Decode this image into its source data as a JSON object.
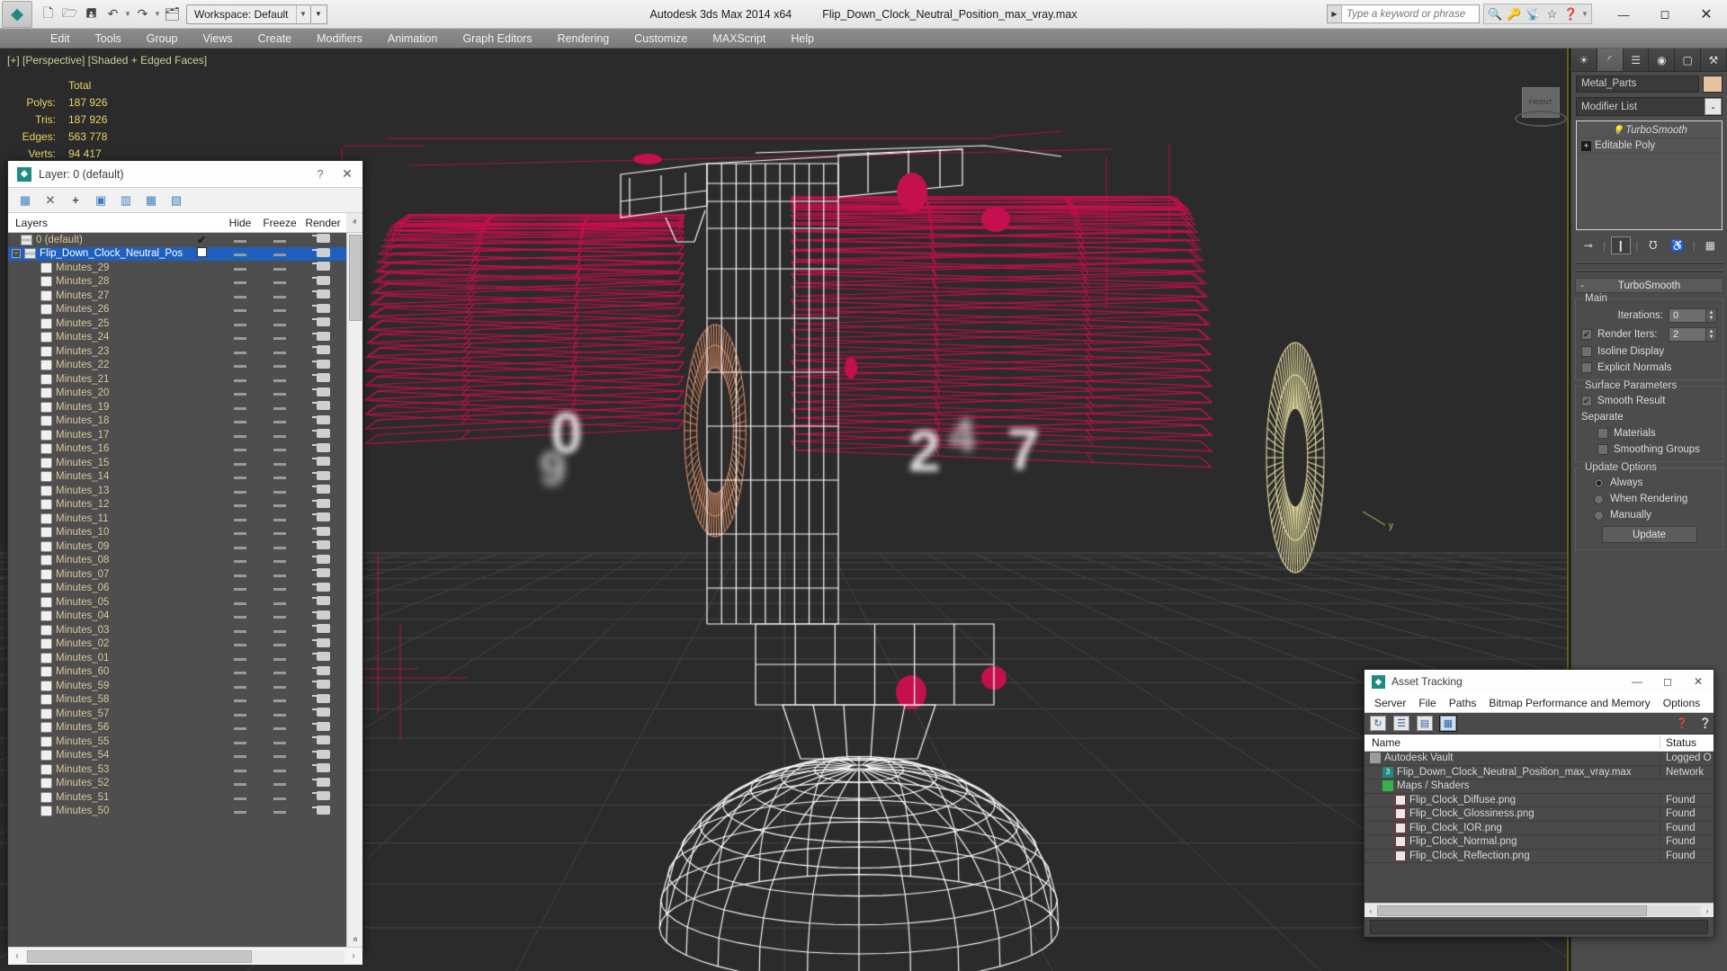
{
  "titlebar": {
    "app_logo": "3ds-max-logo",
    "quick_access": [
      {
        "name": "new-file",
        "glyph": "⬜"
      },
      {
        "name": "open-file",
        "glyph": "🗁"
      },
      {
        "name": "save-file",
        "glyph": "💾"
      },
      {
        "name": "undo",
        "glyph": "↶"
      },
      {
        "name": "redo",
        "glyph": "↷"
      },
      {
        "name": "set-project-folder",
        "glyph": "🗂"
      }
    ],
    "workspace_label": "Workspace: Default",
    "app_title": "Autodesk 3ds Max  2014 x64",
    "file_title": "Flip_Down_Clock_Neutral_Position_max_vray.max",
    "search_placeholder": "Type a keyword or phrase",
    "help_icons": [
      {
        "name": "binoculars-icon",
        "glyph": "🔭"
      },
      {
        "name": "key-icon",
        "glyph": "🔑"
      },
      {
        "name": "satellite-dish-icon",
        "glyph": "📡"
      },
      {
        "name": "star-icon",
        "glyph": "★"
      },
      {
        "name": "help-question-icon",
        "glyph": "?"
      }
    ],
    "window_controls": [
      {
        "name": "minimize-button",
        "glyph": "—"
      },
      {
        "name": "maximize-button",
        "glyph": "☐"
      },
      {
        "name": "close-button",
        "glyph": "✕"
      }
    ]
  },
  "menubar": {
    "items": [
      "Edit",
      "Tools",
      "Group",
      "Views",
      "Create",
      "Modifiers",
      "Animation",
      "Graph Editors",
      "Rendering",
      "Customize",
      "MAXScript",
      "Help"
    ]
  },
  "viewport": {
    "label": "[+] [Perspective] [Shaded + Edged Faces]",
    "stats": {
      "header": "Total",
      "rows": [
        {
          "label": "Polys:",
          "value": "187 926"
        },
        {
          "label": "Tris:",
          "value": "187 926"
        },
        {
          "label": "Edges:",
          "value": "563 778"
        },
        {
          "label": "Verts:",
          "value": "94 417"
        }
      ]
    },
    "viewcube_label": "FRONT",
    "colors": {
      "background": "#2b2b2b",
      "selection_wire": "#c4104f",
      "unselected_wire": "#ffffff",
      "gizmo_orange": "#e8956a",
      "gizmo_yellow": "#e8e0a0",
      "border": "#6f6220"
    }
  },
  "layer_dialog": {
    "title": "Layer: 0 (default)",
    "help_glyph": "?",
    "close_glyph": "✕",
    "toolbar": [
      {
        "name": "new-layer-icon",
        "glyph": "▤"
      },
      {
        "name": "delete-layer-icon",
        "glyph": "✕"
      },
      {
        "name": "add-selection-icon",
        "glyph": "+"
      },
      {
        "name": "select-objects-icon",
        "glyph": "▣"
      },
      {
        "name": "select-highlighted-icon",
        "glyph": "▥"
      },
      {
        "name": "highlight-selected-icon",
        "glyph": "▦"
      },
      {
        "name": "layer-properties-icon",
        "glyph": "▧"
      }
    ],
    "columns": [
      "Layers",
      "",
      "Hide",
      "Freeze",
      "Render"
    ],
    "scroll_up_glyph": "ⱏ",
    "scroll_down_glyph": "ⱞ",
    "hscroll_left_glyph": "‹",
    "hscroll_right_glyph": "›",
    "rows": [
      {
        "label": "0 (default)",
        "indent": 0,
        "icon": "layer-stack-icon",
        "selected": false,
        "expander": false,
        "check": "✔",
        "hide": "dash",
        "freeze": "dash",
        "render": "teapot"
      },
      {
        "label": "Flip_Down_Clock_Neutral_Position",
        "indent": 0,
        "icon": "layer-stack-icon",
        "selected": true,
        "expander": true,
        "check": "box",
        "hide": "dash",
        "freeze": "dash",
        "render": "teapot"
      },
      {
        "label": "Minutes_29",
        "indent": 2,
        "icon": "object-icon",
        "selected": false,
        "hide": "dash",
        "freeze": "dash",
        "render": "teapot"
      },
      {
        "label": "Minutes_28",
        "indent": 2,
        "icon": "object-icon",
        "selected": false,
        "hide": "dash",
        "freeze": "dash",
        "render": "teapot"
      },
      {
        "label": "Minutes_27",
        "indent": 2,
        "icon": "object-icon",
        "selected": false,
        "hide": "dash",
        "freeze": "dash",
        "render": "teapot"
      },
      {
        "label": "Minutes_26",
        "indent": 2,
        "icon": "object-icon",
        "selected": false,
        "hide": "dash",
        "freeze": "dash",
        "render": "teapot"
      },
      {
        "label": "Minutes_25",
        "indent": 2,
        "icon": "object-icon",
        "selected": false,
        "hide": "dash",
        "freeze": "dash",
        "render": "teapot"
      },
      {
        "label": "Minutes_24",
        "indent": 2,
        "icon": "object-icon",
        "selected": false,
        "hide": "dash",
        "freeze": "dash",
        "render": "teapot"
      },
      {
        "label": "Minutes_23",
        "indent": 2,
        "icon": "object-icon",
        "selected": false,
        "hide": "dash",
        "freeze": "dash",
        "render": "teapot"
      },
      {
        "label": "Minutes_22",
        "indent": 2,
        "icon": "object-icon",
        "selected": false,
        "hide": "dash",
        "freeze": "dash",
        "render": "teapot"
      },
      {
        "label": "Minutes_21",
        "indent": 2,
        "icon": "object-icon",
        "selected": false,
        "hide": "dash",
        "freeze": "dash",
        "render": "teapot"
      },
      {
        "label": "Minutes_20",
        "indent": 2,
        "icon": "object-icon",
        "selected": false,
        "hide": "dash",
        "freeze": "dash",
        "render": "teapot"
      },
      {
        "label": "Minutes_19",
        "indent": 2,
        "icon": "object-icon",
        "selected": false,
        "hide": "dash",
        "freeze": "dash",
        "render": "teapot"
      },
      {
        "label": "Minutes_18",
        "indent": 2,
        "icon": "object-icon",
        "selected": false,
        "hide": "dash",
        "freeze": "dash",
        "render": "teapot"
      },
      {
        "label": "Minutes_17",
        "indent": 2,
        "icon": "object-icon",
        "selected": false,
        "hide": "dash",
        "freeze": "dash",
        "render": "teapot"
      },
      {
        "label": "Minutes_16",
        "indent": 2,
        "icon": "object-icon",
        "selected": false,
        "hide": "dash",
        "freeze": "dash",
        "render": "teapot"
      },
      {
        "label": "Minutes_15",
        "indent": 2,
        "icon": "object-icon",
        "selected": false,
        "hide": "dash",
        "freeze": "dash",
        "render": "teapot"
      },
      {
        "label": "Minutes_14",
        "indent": 2,
        "icon": "object-icon",
        "selected": false,
        "hide": "dash",
        "freeze": "dash",
        "render": "teapot"
      },
      {
        "label": "Minutes_13",
        "indent": 2,
        "icon": "object-icon",
        "selected": false,
        "hide": "dash",
        "freeze": "dash",
        "render": "teapot"
      },
      {
        "label": "Minutes_12",
        "indent": 2,
        "icon": "object-icon",
        "selected": false,
        "hide": "dash",
        "freeze": "dash",
        "render": "teapot"
      },
      {
        "label": "Minutes_11",
        "indent": 2,
        "icon": "object-icon",
        "selected": false,
        "hide": "dash",
        "freeze": "dash",
        "render": "teapot"
      },
      {
        "label": "Minutes_10",
        "indent": 2,
        "icon": "object-icon",
        "selected": false,
        "hide": "dash",
        "freeze": "dash",
        "render": "teapot"
      },
      {
        "label": "Minutes_09",
        "indent": 2,
        "icon": "object-icon",
        "selected": false,
        "hide": "dash",
        "freeze": "dash",
        "render": "teapot"
      },
      {
        "label": "Minutes_08",
        "indent": 2,
        "icon": "object-icon",
        "selected": false,
        "hide": "dash",
        "freeze": "dash",
        "render": "teapot"
      },
      {
        "label": "Minutes_07",
        "indent": 2,
        "icon": "object-icon",
        "selected": false,
        "hide": "dash",
        "freeze": "dash",
        "render": "teapot"
      },
      {
        "label": "Minutes_06",
        "indent": 2,
        "icon": "object-icon",
        "selected": false,
        "hide": "dash",
        "freeze": "dash",
        "render": "teapot"
      },
      {
        "label": "Minutes_05",
        "indent": 2,
        "icon": "object-icon",
        "selected": false,
        "hide": "dash",
        "freeze": "dash",
        "render": "teapot"
      },
      {
        "label": "Minutes_04",
        "indent": 2,
        "icon": "object-icon",
        "selected": false,
        "hide": "dash",
        "freeze": "dash",
        "render": "teapot"
      },
      {
        "label": "Minutes_03",
        "indent": 2,
        "icon": "object-icon",
        "selected": false,
        "hide": "dash",
        "freeze": "dash",
        "render": "teapot"
      },
      {
        "label": "Minutes_02",
        "indent": 2,
        "icon": "object-icon",
        "selected": false,
        "hide": "dash",
        "freeze": "dash",
        "render": "teapot"
      },
      {
        "label": "Minutes_01",
        "indent": 2,
        "icon": "object-icon",
        "selected": false,
        "hide": "dash",
        "freeze": "dash",
        "render": "teapot"
      },
      {
        "label": "Minutes_60",
        "indent": 2,
        "icon": "object-icon",
        "selected": false,
        "hide": "dash",
        "freeze": "dash",
        "render": "teapot"
      },
      {
        "label": "Minutes_59",
        "indent": 2,
        "icon": "object-icon",
        "selected": false,
        "hide": "dash",
        "freeze": "dash",
        "render": "teapot"
      },
      {
        "label": "Minutes_58",
        "indent": 2,
        "icon": "object-icon",
        "selected": false,
        "hide": "dash",
        "freeze": "dash",
        "render": "teapot"
      },
      {
        "label": "Minutes_57",
        "indent": 2,
        "icon": "object-icon",
        "selected": false,
        "hide": "dash",
        "freeze": "dash",
        "render": "teapot"
      },
      {
        "label": "Minutes_56",
        "indent": 2,
        "icon": "object-icon",
        "selected": false,
        "hide": "dash",
        "freeze": "dash",
        "render": "teapot"
      },
      {
        "label": "Minutes_55",
        "indent": 2,
        "icon": "object-icon",
        "selected": false,
        "hide": "dash",
        "freeze": "dash",
        "render": "teapot"
      },
      {
        "label": "Minutes_54",
        "indent": 2,
        "icon": "object-icon",
        "selected": false,
        "hide": "dash",
        "freeze": "dash",
        "render": "teapot"
      },
      {
        "label": "Minutes_53",
        "indent": 2,
        "icon": "object-icon",
        "selected": false,
        "hide": "dash",
        "freeze": "dash",
        "render": "teapot"
      },
      {
        "label": "Minutes_52",
        "indent": 2,
        "icon": "object-icon",
        "selected": false,
        "hide": "dash",
        "freeze": "dash",
        "render": "teapot"
      },
      {
        "label": "Minutes_51",
        "indent": 2,
        "icon": "object-icon",
        "selected": false,
        "hide": "dash",
        "freeze": "dash",
        "render": "teapot"
      },
      {
        "label": "Minutes_50",
        "indent": 2,
        "icon": "object-icon",
        "selected": false,
        "hide": "dash",
        "freeze": "dash",
        "render": "teapot"
      }
    ]
  },
  "asset_tracking": {
    "title": "Asset Tracking",
    "window_controls": [
      {
        "name": "minimize-button",
        "glyph": "—"
      },
      {
        "name": "maximize-button",
        "glyph": "☐"
      },
      {
        "name": "close-button",
        "glyph": "✕"
      }
    ],
    "menu": [
      "Server",
      "File",
      "Paths",
      "Bitmap Performance and Memory",
      "Options"
    ],
    "toolbar": [
      {
        "name": "refresh-icon",
        "glyph": "↻",
        "active": false
      },
      {
        "name": "list-view-icon",
        "glyph": "☰",
        "active": false
      },
      {
        "name": "detail-view-icon",
        "glyph": "▤",
        "active": false
      },
      {
        "name": "grid-view-icon",
        "glyph": "▦",
        "active": true
      }
    ],
    "toolbar_right": [
      {
        "name": "network-help-icon",
        "glyph": "❓"
      },
      {
        "name": "vault-help-icon",
        "glyph": "❔"
      }
    ],
    "columns": [
      "Name",
      "Status"
    ],
    "rows": [
      {
        "name": "Autodesk Vault",
        "status": "Logged O",
        "icon": "vault-icon",
        "indent": 0
      },
      {
        "name": "Flip_Down_Clock_Neutral_Position_max_vray.max",
        "status": "Network",
        "icon": "max-file-icon",
        "indent": 1
      },
      {
        "name": "Maps / Shaders",
        "status": "",
        "icon": "maps-shaders-icon",
        "indent": 1
      },
      {
        "name": "Flip_Clock_Diffuse.png",
        "status": "Found",
        "icon": "png-file-icon",
        "indent": 2
      },
      {
        "name": "Flip_Clock_Glossiness.png",
        "status": "Found",
        "icon": "png-file-icon",
        "indent": 2
      },
      {
        "name": "Flip_Clock_IOR.png",
        "status": "Found",
        "icon": "png-file-icon",
        "indent": 2
      },
      {
        "name": "Flip_Clock_Normal.png",
        "status": "Found",
        "icon": "png-file-icon",
        "indent": 2
      },
      {
        "name": "Flip_Clock_Reflection.png",
        "status": "Found",
        "icon": "png-file-icon",
        "indent": 2
      }
    ],
    "hscroll_left_glyph": "‹",
    "hscroll_right_glyph": "›"
  },
  "command_panel": {
    "tabs": [
      {
        "name": "create-tab",
        "glyph": "☀",
        "active": false
      },
      {
        "name": "modify-tab",
        "glyph": "◜",
        "active": true
      },
      {
        "name": "hierarchy-tab",
        "glyph": "⛓",
        "active": false
      },
      {
        "name": "motion-tab",
        "glyph": "◎",
        "active": false
      },
      {
        "name": "display-tab",
        "glyph": "▢",
        "active": false
      },
      {
        "name": "utilities-tab",
        "glyph": "🔨",
        "active": false
      }
    ],
    "object_name": "Metal_Parts",
    "object_color": "#e8c3a0",
    "modifier_list_label": "Modifier List",
    "modifier_dropdown_glyph": "⌄",
    "stack": [
      {
        "label": "TurboSmooth",
        "icon": "lightbulb-icon",
        "active": true,
        "italic": true
      },
      {
        "label": "Editable Poly",
        "icon": "plus-expander-icon",
        "active": false,
        "italic": false
      }
    ],
    "stack_buttons": [
      {
        "name": "pin-stack-icon",
        "glyph": "⊸",
        "on": false
      },
      {
        "name": "show-end-result-icon",
        "glyph": "❙",
        "on": true
      },
      {
        "name": "make-unique-icon",
        "glyph": "⅄",
        "on": false
      },
      {
        "name": "remove-modifier-icon",
        "glyph": "🗑",
        "on": false
      },
      {
        "name": "configure-modifier-sets-icon",
        "glyph": "▦",
        "on": false
      }
    ],
    "rollout": {
      "title": "TurboSmooth",
      "minus_glyph": "-",
      "groups": [
        {
          "label": "Main",
          "fields": [
            {
              "type": "spinner",
              "label": "Iterations:",
              "value": "0",
              "name": "iterations-spinner"
            },
            {
              "type": "checkbox-spinner",
              "label": "Render Iters:",
              "value": "2",
              "checked": true,
              "name": "render-iters"
            },
            {
              "type": "checkbox",
              "label": "Isoline Display",
              "checked": false,
              "name": "isoline-display"
            },
            {
              "type": "checkbox",
              "label": "Explicit Normals",
              "checked": false,
              "name": "explicit-normals"
            }
          ]
        },
        {
          "label": "Surface Parameters",
          "fields": [
            {
              "type": "checkbox",
              "label": "Smooth Result",
              "checked": true,
              "name": "smooth-result"
            },
            {
              "type": "text",
              "label": "Separate",
              "name": "separate-label"
            },
            {
              "type": "checkbox",
              "label": "Materials",
              "checked": false,
              "name": "separate-materials",
              "indent": true
            },
            {
              "type": "checkbox",
              "label": "Smoothing Groups",
              "checked": false,
              "name": "separate-smoothing-groups",
              "indent": true
            }
          ]
        },
        {
          "label": "Update Options",
          "fields": [
            {
              "type": "radio",
              "label": "Always",
              "checked": true,
              "name": "update-always"
            },
            {
              "type": "radio",
              "label": "When Rendering",
              "checked": false,
              "name": "update-when-rendering"
            },
            {
              "type": "radio",
              "label": "Manually",
              "checked": false,
              "name": "update-manually"
            },
            {
              "type": "button",
              "label": "Update",
              "name": "update-button"
            }
          ]
        }
      ]
    }
  }
}
